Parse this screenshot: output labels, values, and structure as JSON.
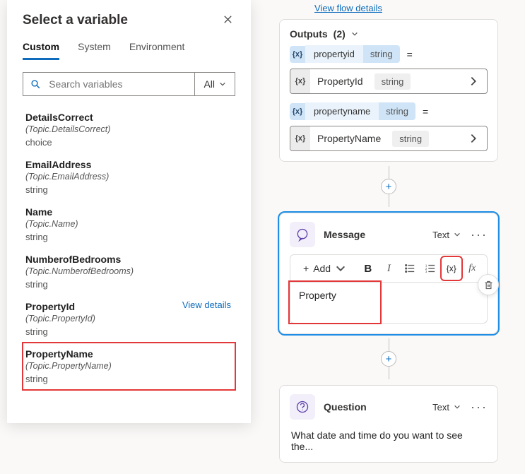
{
  "variablePanel": {
    "title": "Select a variable",
    "tabs": {
      "custom": "Custom",
      "system": "System",
      "environment": "Environment"
    },
    "search": {
      "placeholder": "Search variables",
      "allLabel": "All"
    },
    "viewDetailsLabel": "View details",
    "items": [
      {
        "name": "DetailsCorrect",
        "topic": "(Topic.DetailsCorrect)",
        "type": "choice"
      },
      {
        "name": "EmailAddress",
        "topic": "(Topic.EmailAddress)",
        "type": "string"
      },
      {
        "name": "Name",
        "topic": "(Topic.Name)",
        "type": "string"
      },
      {
        "name": "NumberofBedrooms",
        "topic": "(Topic.NumberofBedrooms)",
        "type": "string"
      },
      {
        "name": "PropertyId",
        "topic": "(Topic.PropertyId)",
        "type": "string"
      },
      {
        "name": "PropertyName",
        "topic": "(Topic.PropertyName)",
        "type": "string"
      }
    ]
  },
  "canvas": {
    "topLink": "View flow details",
    "outputsCard": {
      "title": "Outputs",
      "count": "(2)",
      "rows": [
        {
          "pillName": "propertyid",
          "pillType": "string",
          "setName": "PropertyId",
          "setType": "string"
        },
        {
          "pillName": "propertyname",
          "pillType": "string",
          "setName": "PropertyName",
          "setType": "string"
        }
      ]
    },
    "messageCard": {
      "title": "Message",
      "textLabel": "Text",
      "addLabel": "Add",
      "varGlyph": "{x}",
      "fxGlyph": "fx",
      "body": "Property"
    },
    "questionCard": {
      "title": "Question",
      "textLabel": "Text",
      "body": "What date and time do you want to see the..."
    },
    "equals": "="
  }
}
